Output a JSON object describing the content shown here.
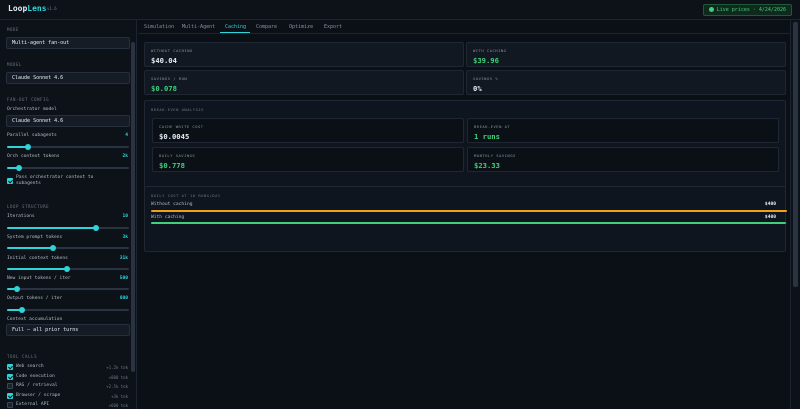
{
  "app": {
    "logo_prefix": "Loop",
    "logo_suffix": "Lens",
    "version": "v1.6",
    "live_prices": "Live prices · 4/24/2026"
  },
  "sidebar": {
    "mode": {
      "section": "MODE",
      "value": "Multi-agent fan-out"
    },
    "model": {
      "section": "MODEL",
      "value": "Claude Sonnet 4.6"
    },
    "fanout": {
      "section": "FAN-OUT CONFIG",
      "orch_label": "Orchestrator model",
      "orch_value": "Claude Sonnet 4.6",
      "subagents_label": "Parallel subagents",
      "subagents_value": "4",
      "subagents_level": 0.17,
      "orch_ctx_label": "Orch context tokens",
      "orch_ctx_value": "2k",
      "orch_ctx_level": 0.1,
      "pass_label_1": "Pass orchestrator context to",
      "pass_label_2": "subagents",
      "pass_checked": true
    },
    "loop": {
      "section": "LOOP STRUCTURE",
      "iter_label": "Iterations",
      "iter_value": "10",
      "iter_level": 0.73,
      "sys_label": "System prompt tokens",
      "sys_value": "3k",
      "sys_level": 0.38,
      "init_label": "Initial context tokens",
      "init_value": "31k",
      "init_level": 0.49,
      "new_label": "New input tokens / iter",
      "new_value": "500",
      "new_level": 0.08,
      "out_label": "Output tokens / iter",
      "out_value": "800",
      "out_level": 0.12,
      "accum_label": "Context accumulation",
      "accum_value": "Full — all prior turns"
    },
    "tools": {
      "section": "TOOL CALLS",
      "items": [
        {
          "label": "Web search",
          "cost": "+1.2k tok",
          "checked": true
        },
        {
          "label": "Code execution",
          "cost": "+800 tok",
          "checked": true
        },
        {
          "label": "RAG / retrieval",
          "cost": "+2.5k tok",
          "checked": false
        },
        {
          "label": "Browser / scrape",
          "cost": "+3k tok",
          "checked": true
        },
        {
          "label": "External API",
          "cost": "+600 tok",
          "checked": false
        }
      ]
    }
  },
  "tabs": [
    {
      "label": "Simulation"
    },
    {
      "label": "Multi-Agent"
    },
    {
      "label": "Caching"
    },
    {
      "label": "Compare"
    },
    {
      "label": "Optimize"
    },
    {
      "label": "Export"
    }
  ],
  "active_tab": "Caching",
  "summary": {
    "without_label": "WITHOUT CACHING",
    "without_value": "$40.04",
    "with_label": "WITH CACHING",
    "with_value": "$39.96",
    "savings_run_label": "SAVINGS / RUN",
    "savings_run_value": "$0.078",
    "savings_pct_label": "SAVINGS %",
    "savings_pct_value": "0%"
  },
  "breakeven": {
    "title": "BREAK-EVEN ANALYSIS",
    "write_label": "CACHE WRITE COST",
    "write_value": "$0.0045",
    "even_label": "BREAK-EVEN AT",
    "even_value": "1 runs",
    "daily_label": "DAILY SAVINGS",
    "daily_value": "$0.778",
    "monthly_label": "MONTHLY SAVINGS",
    "monthly_value": "$23.33"
  },
  "daily_cost": {
    "title": "DAILY COST AT 10 RUNS/DAY",
    "without_label": "Without caching",
    "without_value": "$400",
    "without_level": 1.0,
    "with_label": "With caching",
    "with_value": "$400",
    "with_level": 0.998
  },
  "colors": {
    "accent": "#2dd4d9",
    "without_bar": "#f0a020",
    "with_bar": "#3fd07a",
    "success": "#3fd07a"
  }
}
